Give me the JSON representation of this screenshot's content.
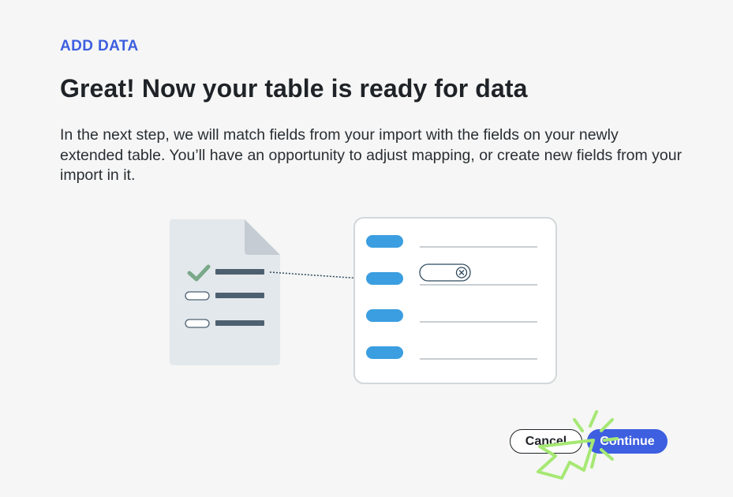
{
  "header": {
    "eyebrow": "ADD DATA",
    "title": "Great! Now your table is ready for data"
  },
  "description": "In the next step, we will match fields from your import with the fields on your newly extended table. You’ll have an opportunity to adjust mapping, or create new fields from your import in it.",
  "actions": {
    "cancel_label": "Cancel",
    "continue_label": "Continue"
  },
  "colors": {
    "accent": "#3d5fe0",
    "field_pill": "#3b9ee0",
    "check": "#7aa88a",
    "doc": "#e3e8ec",
    "doc_fold": "#c5ccd3",
    "cursor_highlight": "#a6e874"
  },
  "icons": {
    "check": "check-icon",
    "clear": "clear-x-icon",
    "cursor": "pointer-cursor-icon"
  }
}
